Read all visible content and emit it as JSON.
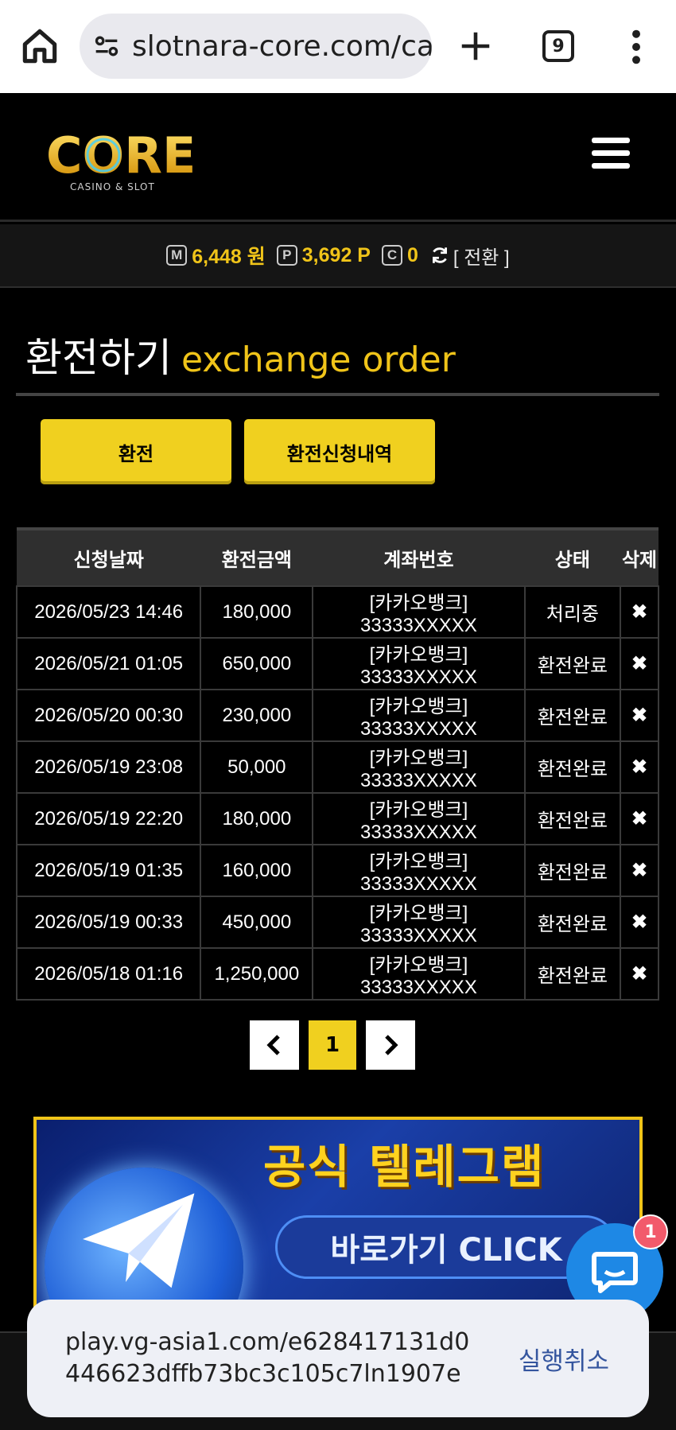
{
  "browser": {
    "url": "slotnara-core.com/ca",
    "tab_count": "9"
  },
  "header": {
    "logo_text": "CORE",
    "logo_sub": "CASINO & SLOT"
  },
  "balance": {
    "money_icon": "M",
    "money": "6,448 원",
    "point_icon": "P",
    "point": "3,692 P",
    "coin_icon": "C",
    "coin": "0",
    "switch_label": "[ 전환 ]"
  },
  "page": {
    "title_ko": "환전하기",
    "title_en": "exchange order"
  },
  "buttons": {
    "exchange": "환전",
    "history": "환전신청내역"
  },
  "table": {
    "headers": [
      "신청날짜",
      "환전금액",
      "계좌번호",
      "상태",
      "삭제"
    ],
    "rows": [
      {
        "date": "2026/05/23 14:46",
        "amount": "180,000",
        "account": "[카카오뱅크] 33333XXXXX",
        "status": "처리중",
        "delete": "✖"
      },
      {
        "date": "2026/05/21 01:05",
        "amount": "650,000",
        "account": "[카카오뱅크] 33333XXXXX",
        "status": "환전완료",
        "delete": "✖"
      },
      {
        "date": "2026/05/20 00:30",
        "amount": "230,000",
        "account": "[카카오뱅크] 33333XXXXX",
        "status": "환전완료",
        "delete": "✖"
      },
      {
        "date": "2026/05/19 23:08",
        "amount": "50,000",
        "account": "[카카오뱅크] 33333XXXXX",
        "status": "환전완료",
        "delete": "✖"
      },
      {
        "date": "2026/05/19 22:20",
        "amount": "180,000",
        "account": "[카카오뱅크] 33333XXXXX",
        "status": "환전완료",
        "delete": "✖"
      },
      {
        "date": "2026/05/19 01:35",
        "amount": "160,000",
        "account": "[카카오뱅크] 33333XXXXX",
        "status": "환전완료",
        "delete": "✖"
      },
      {
        "date": "2026/05/19 00:33",
        "amount": "450,000",
        "account": "[카카오뱅크] 33333XXXXX",
        "status": "환전완료",
        "delete": "✖"
      },
      {
        "date": "2026/05/18 01:16",
        "amount": "1,250,000",
        "account": "[카카오뱅크] 33333XXXXX",
        "status": "환전완료",
        "delete": "✖"
      }
    ]
  },
  "pagination": {
    "prev": "‹",
    "current": "1",
    "next": "›"
  },
  "banner": {
    "title": "공식 텔레그램",
    "subtitle": "바로가기 CLICK"
  },
  "chat": {
    "badge": "1"
  },
  "toast": {
    "text": "play.vg-asia1.com/e628417131d0446623dffb73bc3c105c7ln1907e",
    "action": "실행취소"
  },
  "colors": {
    "accent": "#f0d01f",
    "link": "#5a9eea",
    "chat": "#1e88e5"
  }
}
